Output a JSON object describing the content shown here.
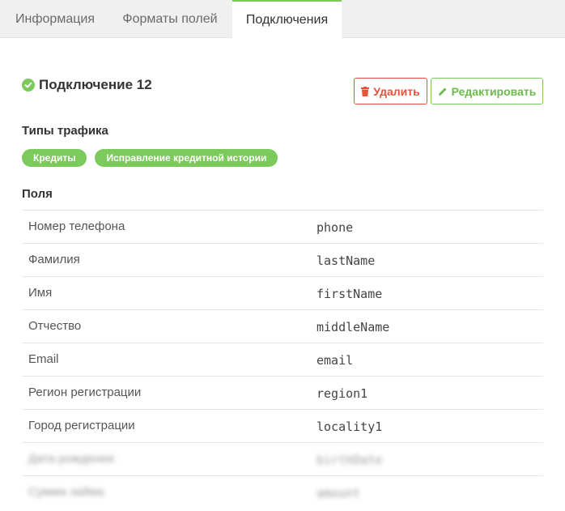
{
  "tabs": [
    {
      "label": "Информация"
    },
    {
      "label": "Форматы полей"
    },
    {
      "label": "Подключения"
    }
  ],
  "connection": {
    "title": "Подключение 12",
    "delete_label": "Удалить",
    "edit_label": "Редактировать"
  },
  "traffic": {
    "heading": "Типы трафика",
    "badges": [
      "Кредиты",
      "Исправление кредитной истории"
    ]
  },
  "fields": {
    "heading": "Поля",
    "rows": [
      {
        "label": "Номер телефона",
        "value": "phone"
      },
      {
        "label": "Фамилия",
        "value": "lastName"
      },
      {
        "label": "Имя",
        "value": "firstName"
      },
      {
        "label": "Отчество",
        "value": "middleName"
      },
      {
        "label": "Email",
        "value": "email"
      },
      {
        "label": "Регион регистрации",
        "value": "region1"
      },
      {
        "label": "Город регистрации",
        "value": "locality1"
      },
      {
        "label": "Дата рождения",
        "value": "birthDate"
      },
      {
        "label": "Сумма займа",
        "value": "amount"
      }
    ]
  },
  "colors": {
    "accent_green": "#7cc95c",
    "danger_red": "#e5533b"
  }
}
